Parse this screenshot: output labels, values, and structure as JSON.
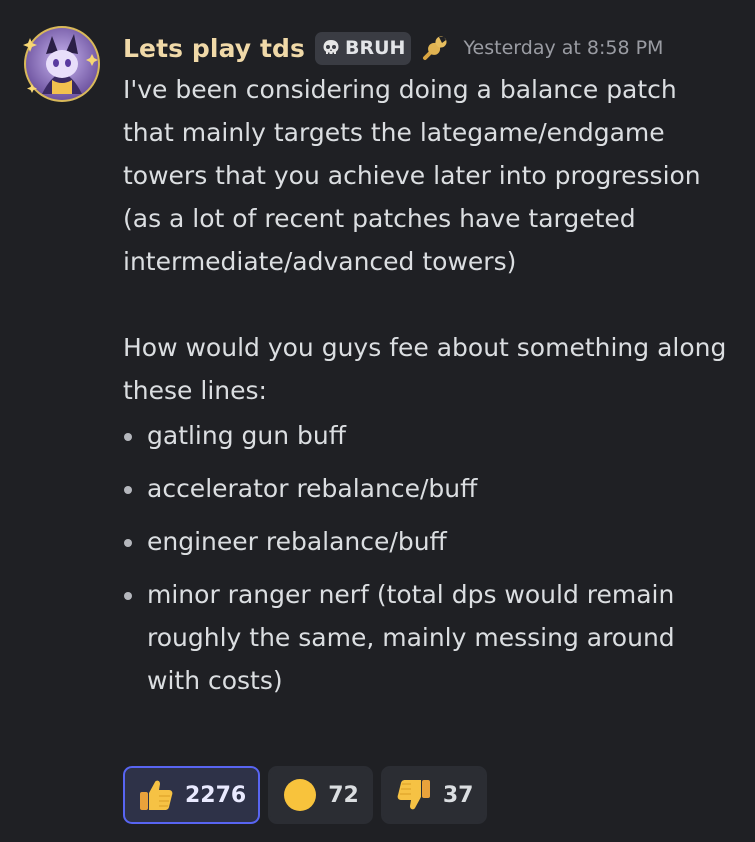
{
  "message": {
    "author": {
      "username": "Lets play tds",
      "name_color": "#f0d9a8",
      "tag": {
        "icon": "skull-icon",
        "label": "BRUH"
      },
      "badge_icon": "wrench-icon"
    },
    "timestamp": "Yesterday at 8:58 PM",
    "paragraphs": [
      "I've been considering doing a balance patch that mainly targets the lategame/endgame towers that you achieve later into progression (as a lot of recent patches have targeted intermediate/advanced towers)",
      "How would you guys fee about something along these lines:"
    ],
    "bullets": [
      "gatling gun buff",
      "accelerator rebalance/buff",
      "engineer rebalance/buff",
      "minor ranger nerf (total dps would remain roughly the same, mainly messing around with costs)"
    ]
  },
  "reactions": [
    {
      "emoji": "thumbs-up-icon",
      "count": "2276",
      "selected": true
    },
    {
      "emoji": "yellow-circle-icon",
      "count": "72",
      "selected": false
    },
    {
      "emoji": "thumbs-down-icon",
      "count": "37",
      "selected": false
    }
  ],
  "colors": {
    "background": "#1f2024",
    "accent": "#5865f2",
    "text": "#dbdee1",
    "muted": "#9a9ca3"
  }
}
